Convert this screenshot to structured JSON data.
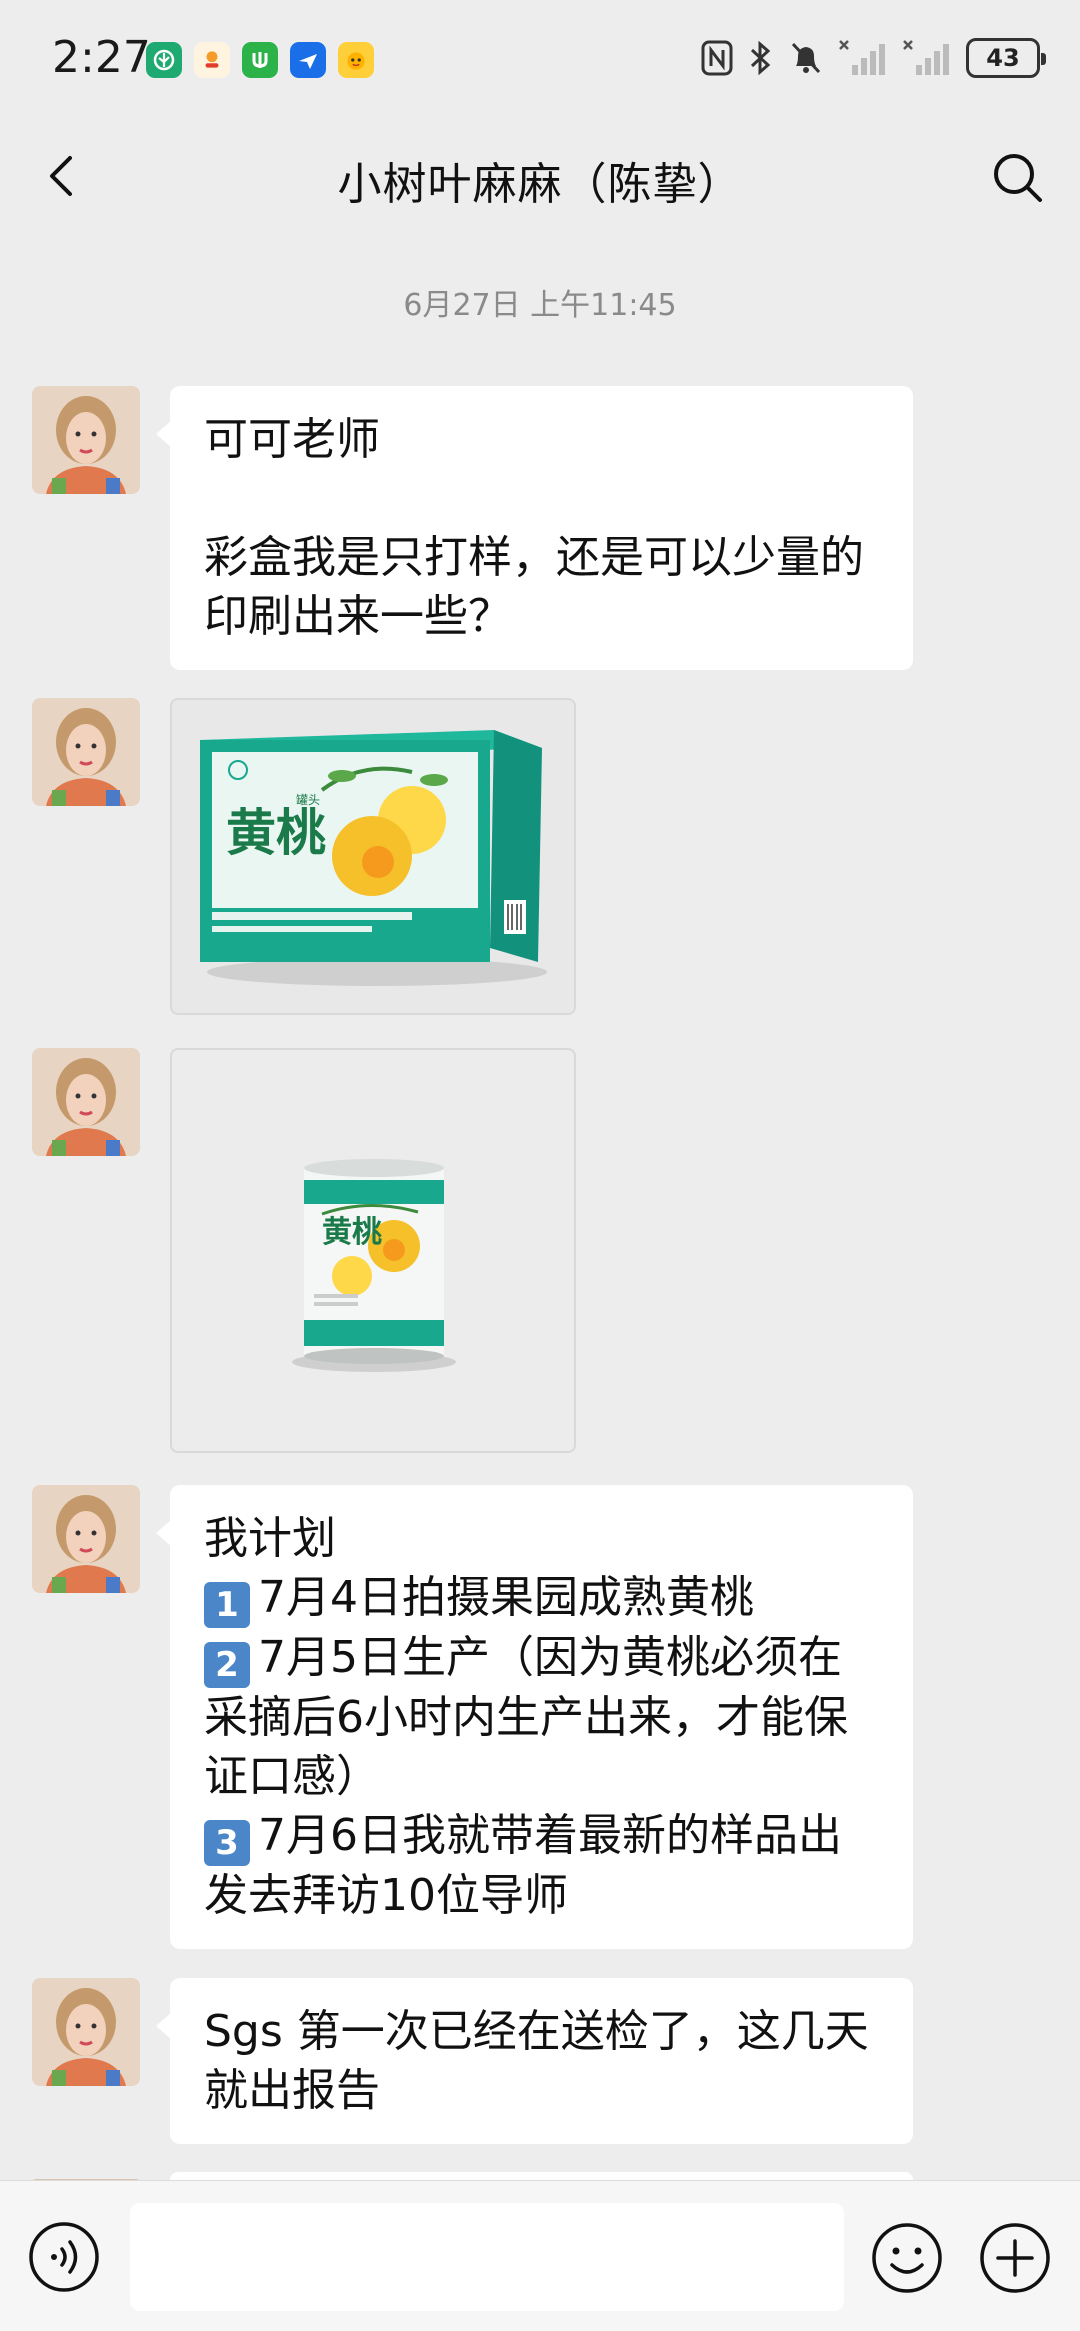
{
  "status": {
    "time": "2:27",
    "battery": "43"
  },
  "header": {
    "title": "小树叶麻麻（陈挚）"
  },
  "chat": {
    "timestamp": "6月27日 上午11:45",
    "messages": [
      {
        "lines": [
          "可可老师",
          "",
          "彩盒我是只打样，还是可以少量的",
          "印刷出来一些？"
        ]
      },
      {
        "image": "peach-gift-box"
      },
      {
        "image": "peach-can"
      },
      {
        "plan_title": "我计划",
        "plan": [
          {
            "num": "1",
            "lines": [
              "7月4日拍摄果园成熟黄桃"
            ]
          },
          {
            "num": "2",
            "lines": [
              "7月5日生产（因为黄桃必须在",
              "采摘后6小时内生产出来，才能保",
              "证口感）"
            ]
          },
          {
            "num": "3",
            "lines": [
              "7月6日我就带着最新的样品出",
              "发去拜访10位导师"
            ]
          }
        ]
      },
      {
        "lines": [
          "Sgs 第一次已经在送检了，这几天",
          "就出报告"
        ]
      }
    ]
  },
  "product": {
    "name": "黄桃",
    "tag": "罐头"
  },
  "icons": [
    "back-icon",
    "search-icon",
    "voice-icon",
    "emoji-icon",
    "plus-icon"
  ],
  "colors": {
    "background": "#ededed",
    "bubble": "#ffffff",
    "package_teal": "#16a88f"
  }
}
